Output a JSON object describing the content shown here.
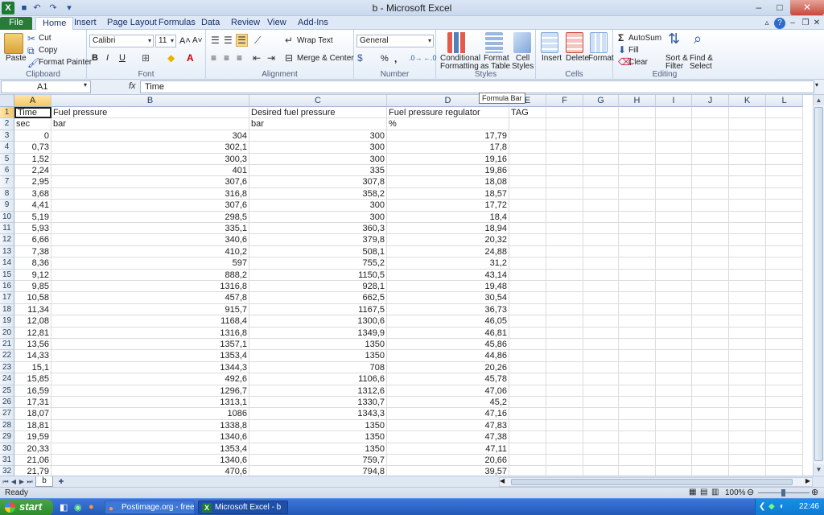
{
  "window": {
    "title": "b  -  Microsoft Excel",
    "controls": {
      "minimize": "–",
      "maximize": "□",
      "close": "✕"
    }
  },
  "ribbon_tabs": [
    "File",
    "Home",
    "Insert",
    "Page Layout",
    "Formulas",
    "Data",
    "Review",
    "View",
    "Add-Ins"
  ],
  "ribbon": {
    "clipboard": {
      "label": "Clipboard",
      "paste": "Paste",
      "cut": "Cut",
      "copy": "Copy",
      "format_painter": "Format Painter"
    },
    "font": {
      "label": "Font",
      "name": "Calibri",
      "size": "11",
      "bold": "B",
      "italic": "I",
      "underline": "U"
    },
    "alignment": {
      "label": "Alignment",
      "wrap": "Wrap Text",
      "merge": "Merge & Center"
    },
    "number": {
      "label": "Number",
      "format": "General",
      "percent": "%",
      "comma": ","
    },
    "styles": {
      "label": "Styles",
      "conditional": "Conditional",
      "conditional2": "Formatting",
      "format_table": "Format",
      "format_table2": "as Table",
      "cell_styles": "Cell",
      "cell_styles2": "Styles"
    },
    "cells": {
      "label": "Cells",
      "insert": "Insert",
      "delete": "Delete",
      "format": "Format"
    },
    "editing": {
      "label": "Editing",
      "autosum": "AutoSum",
      "fill": "Fill",
      "clear": "Clear",
      "sort": "Sort &",
      "sort2": "Filter",
      "find": "Find &",
      "find2": "Select"
    }
  },
  "formula_bar": {
    "name_box": "A1",
    "fx": "fx",
    "content": "Time",
    "tooltip": "Formula Bar"
  },
  "columns": [
    "A",
    "B",
    "C",
    "D",
    "E",
    "F",
    "G",
    "H",
    "I",
    "J",
    "K",
    "L"
  ],
  "header_rows": [
    [
      "Time",
      "Fuel pressure",
      "Desired fuel pressure",
      "Fuel pressure regulator",
      "TAG"
    ],
    [
      "sec",
      "bar",
      "bar",
      "%",
      ""
    ]
  ],
  "rows": [
    [
      "0",
      "304",
      "300",
      "17,79"
    ],
    [
      "0,73",
      "302,1",
      "300",
      "17,8"
    ],
    [
      "1,52",
      "300,3",
      "300",
      "19,16"
    ],
    [
      "2,24",
      "401",
      "335",
      "19,86"
    ],
    [
      "2,95",
      "307,6",
      "307,8",
      "18,08"
    ],
    [
      "3,68",
      "316,8",
      "358,2",
      "18,57"
    ],
    [
      "4,41",
      "307,6",
      "300",
      "17,72"
    ],
    [
      "5,19",
      "298,5",
      "300",
      "18,4"
    ],
    [
      "5,93",
      "335,1",
      "360,3",
      "18,94"
    ],
    [
      "6,66",
      "340,6",
      "379,8",
      "20,32"
    ],
    [
      "7,38",
      "410,2",
      "508,1",
      "24,88"
    ],
    [
      "8,36",
      "597",
      "755,2",
      "31,2"
    ],
    [
      "9,12",
      "888,2",
      "1150,5",
      "43,14"
    ],
    [
      "9,85",
      "1316,8",
      "928,1",
      "19,48"
    ],
    [
      "10,58",
      "457,8",
      "662,5",
      "30,54"
    ],
    [
      "11,34",
      "915,7",
      "1167,5",
      "36,73"
    ],
    [
      "12,08",
      "1168,4",
      "1300,6",
      "46,05"
    ],
    [
      "12,81",
      "1316,8",
      "1349,9",
      "46,81"
    ],
    [
      "13,56",
      "1357,1",
      "1350",
      "45,86"
    ],
    [
      "14,33",
      "1353,4",
      "1350",
      "44,86"
    ],
    [
      "15,1",
      "1344,3",
      "708",
      "20,26"
    ],
    [
      "15,85",
      "492,6",
      "1106,6",
      "45,78"
    ],
    [
      "16,59",
      "1296,7",
      "1312,6",
      "47,06"
    ],
    [
      "17,31",
      "1313,1",
      "1330,7",
      "45,2"
    ],
    [
      "18,07",
      "1086",
      "1343,3",
      "47,16"
    ],
    [
      "18,81",
      "1338,8",
      "1350",
      "47,83"
    ],
    [
      "19,59",
      "1340,6",
      "1350",
      "47,38"
    ],
    [
      "20,33",
      "1353,4",
      "1350",
      "47,11"
    ],
    [
      "21,06",
      "1340,6",
      "759,7",
      "20,66"
    ],
    [
      "21,79",
      "470,6",
      "794,8",
      "39,57"
    ]
  ],
  "sheet_tab": "b",
  "status": {
    "ready": "Ready",
    "zoom": "100%"
  },
  "taskbar": {
    "start": "start",
    "task1": "Postimage.org - free i...",
    "task2": "Microsoft Excel - b",
    "clock": "22:46"
  }
}
